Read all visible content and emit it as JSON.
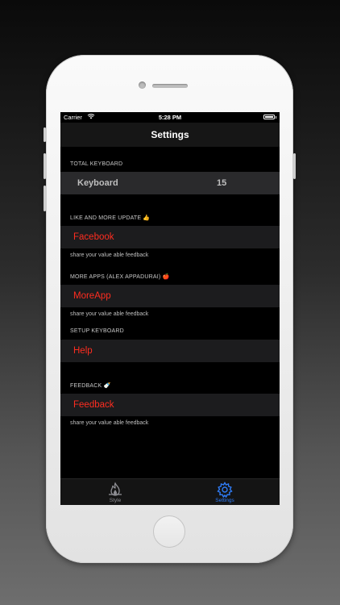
{
  "status_bar": {
    "carrier": "Carrier",
    "time": "5:28 PM"
  },
  "nav": {
    "title": "Settings"
  },
  "sections": {
    "total_keyboard": {
      "header": "TOTAL KEYBOARD",
      "label": "Keyboard",
      "value": "15"
    },
    "like": {
      "header": "LIKE AND MORE UPDATE 👍",
      "row": "Facebook",
      "footer": "share your value able feedback"
    },
    "more_apps": {
      "header": "MORE APPS (ALEX APPADURAI) 🍎",
      "row": "MoreApp",
      "footer": "share your value able feedback"
    },
    "setup": {
      "header": "SETUP KEYBOARD",
      "row": "Help"
    },
    "feedback": {
      "header": "FEEDBACK 🍼",
      "row": "Feedback",
      "footer": "share your value able feedback"
    }
  },
  "tabs": [
    {
      "label": "Style",
      "icon": "flame-icon",
      "active": false
    },
    {
      "label": "Settings",
      "icon": "gear-icon",
      "active": true
    }
  ],
  "colors": {
    "accent_red": "#ff2d20",
    "tab_active": "#2f7cf6",
    "tab_inactive": "#8e8e93"
  }
}
